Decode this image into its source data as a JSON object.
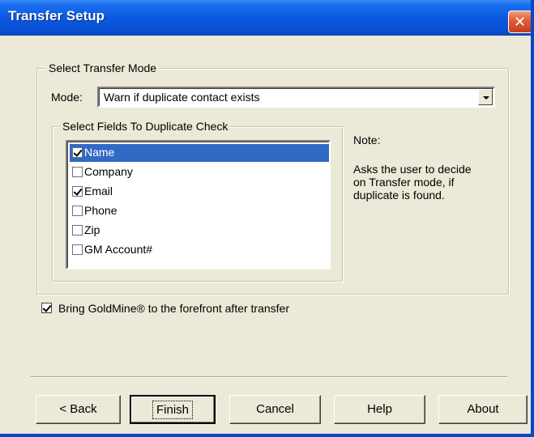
{
  "window": {
    "title": "Transfer Setup",
    "close_symbol": "✕"
  },
  "transfer_mode": {
    "group_label": "Select Transfer Mode",
    "mode_label": "Mode:",
    "mode_value": "Warn if duplicate contact exists"
  },
  "fields": {
    "group_label": "Select Fields To Duplicate Check",
    "items": [
      {
        "label": "Name",
        "checked": true,
        "selected": true
      },
      {
        "label": "Company",
        "checked": false,
        "selected": false
      },
      {
        "label": "Email",
        "checked": true,
        "selected": false
      },
      {
        "label": "Phone",
        "checked": false,
        "selected": false
      },
      {
        "label": "Zip",
        "checked": false,
        "selected": false
      },
      {
        "label": "GM Account#",
        "checked": false,
        "selected": false
      }
    ]
  },
  "note": {
    "title": "Note:",
    "text": "Asks the user to decide\non Transfer mode, if\nduplicate is found."
  },
  "bring_to_front": {
    "label": "Bring GoldMine® to the forefront after transfer",
    "checked": true
  },
  "buttons": {
    "back": "< Back",
    "finish": "Finish",
    "cancel": "Cancel",
    "help": "Help",
    "about": "About"
  }
}
